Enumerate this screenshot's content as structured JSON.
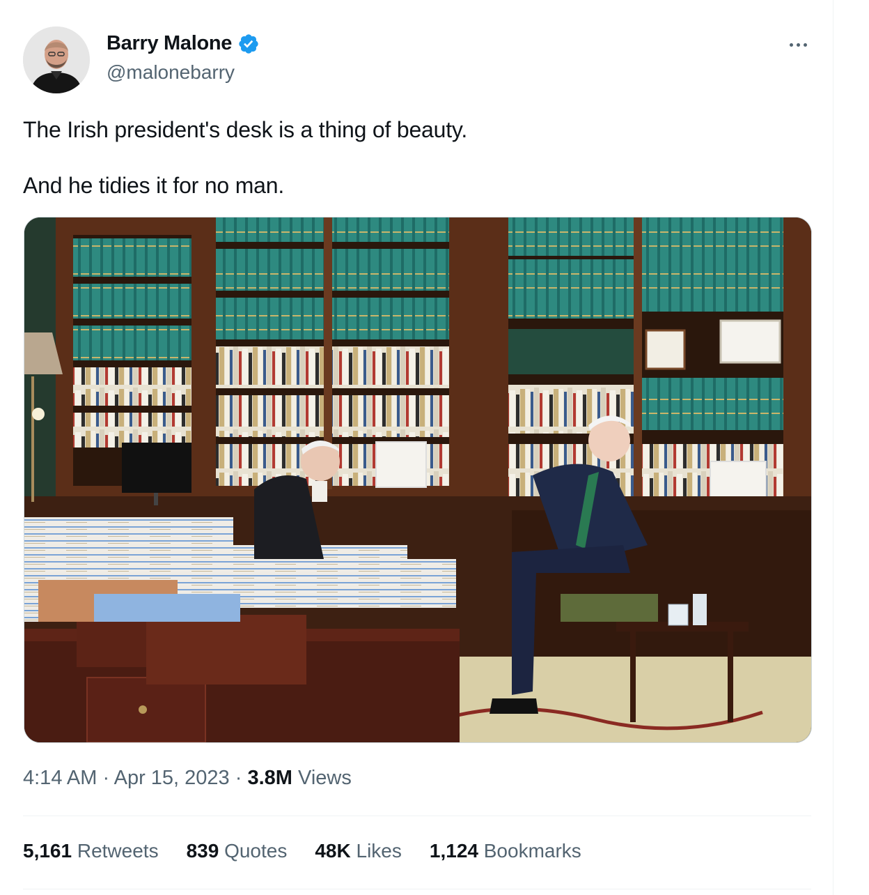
{
  "author": {
    "display_name": "Barry Malone",
    "handle": "@malonebarry"
  },
  "tweet": {
    "lines": [
      "The Irish president's desk is a thing of beauty.",
      "And he tidies it for no man."
    ]
  },
  "meta": {
    "time": "4:14 AM",
    "separator": "·",
    "date": "Apr 15, 2023",
    "views_count": "3.8M",
    "views_label": "Views"
  },
  "stats": {
    "retweets_count": "5,161",
    "retweets_label": "Retweets",
    "quotes_count": "839",
    "quotes_label": "Quotes",
    "likes_count": "48K",
    "likes_label": "Likes",
    "bookmarks_count": "1,124",
    "bookmarks_label": "Bookmarks"
  },
  "icons": {
    "verified": "verified-badge-icon",
    "more": "more-options-icon"
  },
  "colors": {
    "verified_blue": "#1d9bf0",
    "secondary_text": "#536471",
    "primary_text": "#0f1419",
    "divider": "#eff3f4"
  }
}
